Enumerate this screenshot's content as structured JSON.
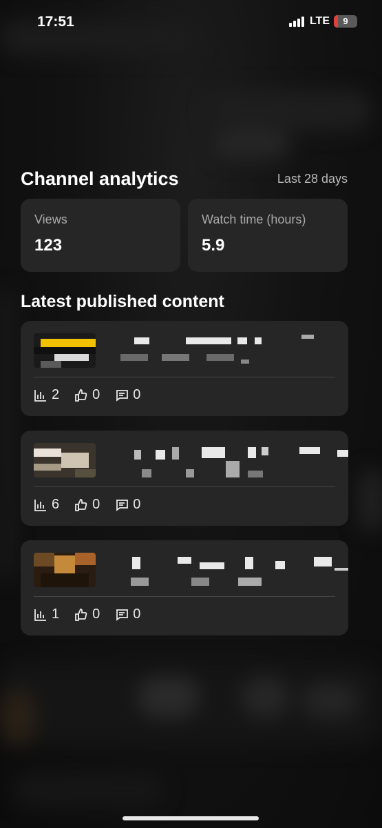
{
  "status_bar": {
    "time": "17:51",
    "network": "LTE",
    "battery": "9"
  },
  "analytics": {
    "title": "Channel analytics",
    "period": "Last 28 days",
    "stats": [
      {
        "label": "Views",
        "value": "123"
      },
      {
        "label": "Watch time (hours)",
        "value": "5.9"
      }
    ]
  },
  "latest": {
    "title": "Latest published content",
    "items": [
      {
        "views": "2",
        "likes": "0",
        "comments": "0"
      },
      {
        "views": "6",
        "likes": "0",
        "comments": "0"
      },
      {
        "views": "1",
        "likes": "0",
        "comments": "0"
      }
    ]
  },
  "icons": {
    "views": "bar-chart-icon",
    "likes": "thumbs-up-icon",
    "comments": "comment-icon"
  },
  "colors": {
    "background": "#0f0f0f",
    "card": "#262626",
    "battery_low": "#e0413a"
  }
}
